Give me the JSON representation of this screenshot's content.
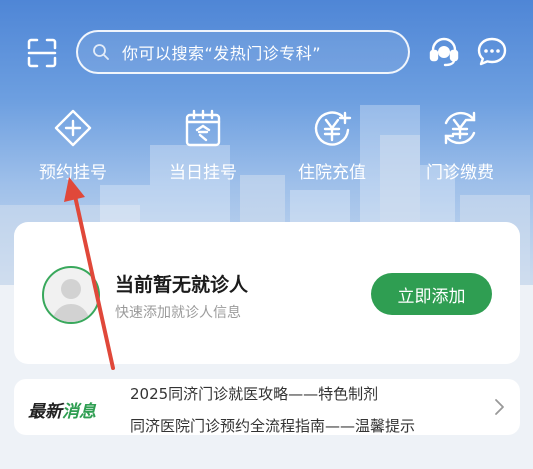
{
  "search": {
    "placeholder": "你可以搜索“发热门诊专科”"
  },
  "quick_actions": [
    {
      "label": "预约挂号",
      "icon": "plus-diamond-icon"
    },
    {
      "label": "当日挂号",
      "icon": "calendar-today-icon"
    },
    {
      "label": "住院充值",
      "icon": "yuan-plus-icon"
    },
    {
      "label": "门诊缴费",
      "icon": "yuan-refresh-icon"
    }
  ],
  "patient_card": {
    "title": "当前暂无就诊人",
    "subtitle": "快速添加就诊人信息",
    "add_label": "立即添加"
  },
  "news": {
    "badge_part1": "最新",
    "badge_part2": "消息",
    "line1": "2025同济门诊就医攻略——特色制剂",
    "line2": "同济医院门诊预约全流程指南——温馨提示"
  },
  "icons": {
    "top_left": "scan-icon",
    "search": "search-icon",
    "service": "customer-service-icon",
    "chat": "chat-bubble-icon",
    "news_more": "chevron-right-icon"
  },
  "colors": {
    "accent_green": "#2f9e52",
    "hero_blue": "#4f86d6",
    "annotation_red": "#e0483a"
  }
}
